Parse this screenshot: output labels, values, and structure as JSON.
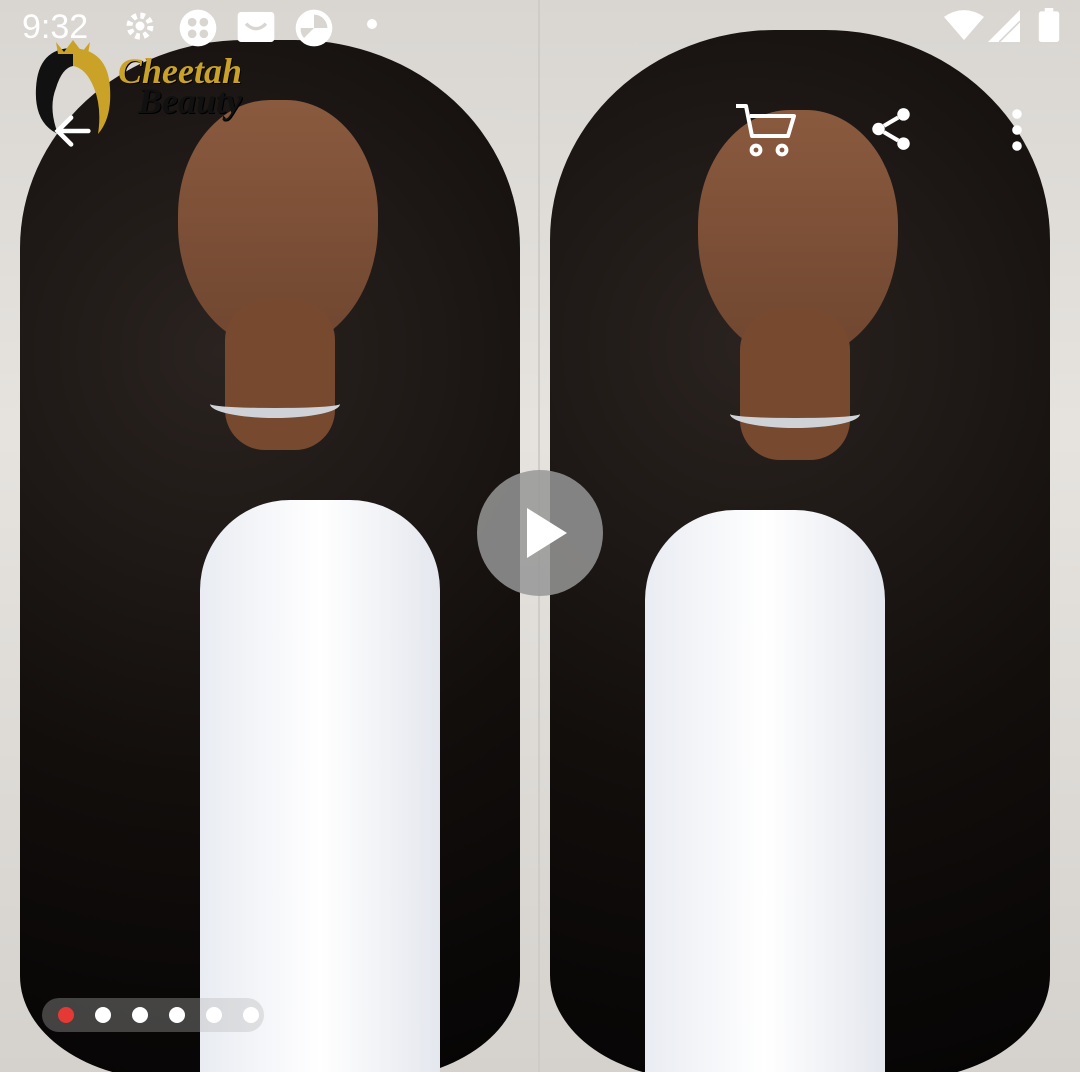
{
  "status_bar": {
    "time": "9:32",
    "icons": [
      "settings-icon",
      "app-icon",
      "mail-icon",
      "browser-icon",
      "dot-icon",
      "wifi-icon",
      "signal-icon",
      "battery-icon"
    ]
  },
  "logo": {
    "line1": "Cheetah",
    "line2": "Beauty"
  },
  "toolbar": {
    "back": "back-arrow-icon",
    "cart": "cart-icon",
    "share": "share-icon",
    "more": "more-vertical-icon"
  },
  "media": {
    "play": "play-icon"
  },
  "pager": {
    "count": 6,
    "active_index": 0
  },
  "colors": {
    "active_dot": "#e53935",
    "dot": "#ffffff",
    "play_bg": "#969696"
  }
}
